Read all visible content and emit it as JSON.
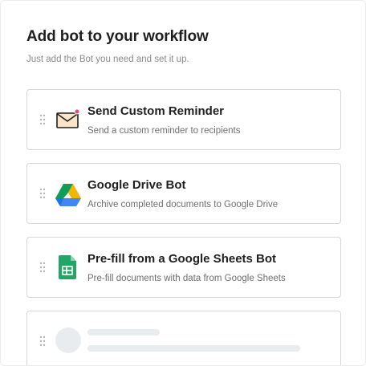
{
  "header": {
    "title": "Add bot to your workflow",
    "subtitle": "Just add the Bot you need and set it up."
  },
  "bots": [
    {
      "title": "Send Custom Reminder",
      "description": "Send a custom reminder to recipients",
      "icon": "envelope-icon"
    },
    {
      "title": "Google Drive Bot",
      "description": "Archive completed documents to Google Drive",
      "icon": "google-drive-icon"
    },
    {
      "title": "Pre-fill from a Google Sheets Bot",
      "description": "Pre-fill documents with data from Google Sheets",
      "icon": "google-sheets-icon"
    }
  ],
  "loading_placeholder": {
    "icon": "skeleton-avatar"
  },
  "colors": {
    "card_border": "#d7d7d7",
    "notification_dot": "#e34c6b",
    "envelope_outline": "#1f1f1f",
    "envelope_fill": "#fbe5c8",
    "drive_green": "#0f9d58",
    "drive_yellow": "#f4b400",
    "drive_blue": "#4285f4",
    "sheets_green": "#23a566",
    "skeleton": "#e9ecef"
  }
}
